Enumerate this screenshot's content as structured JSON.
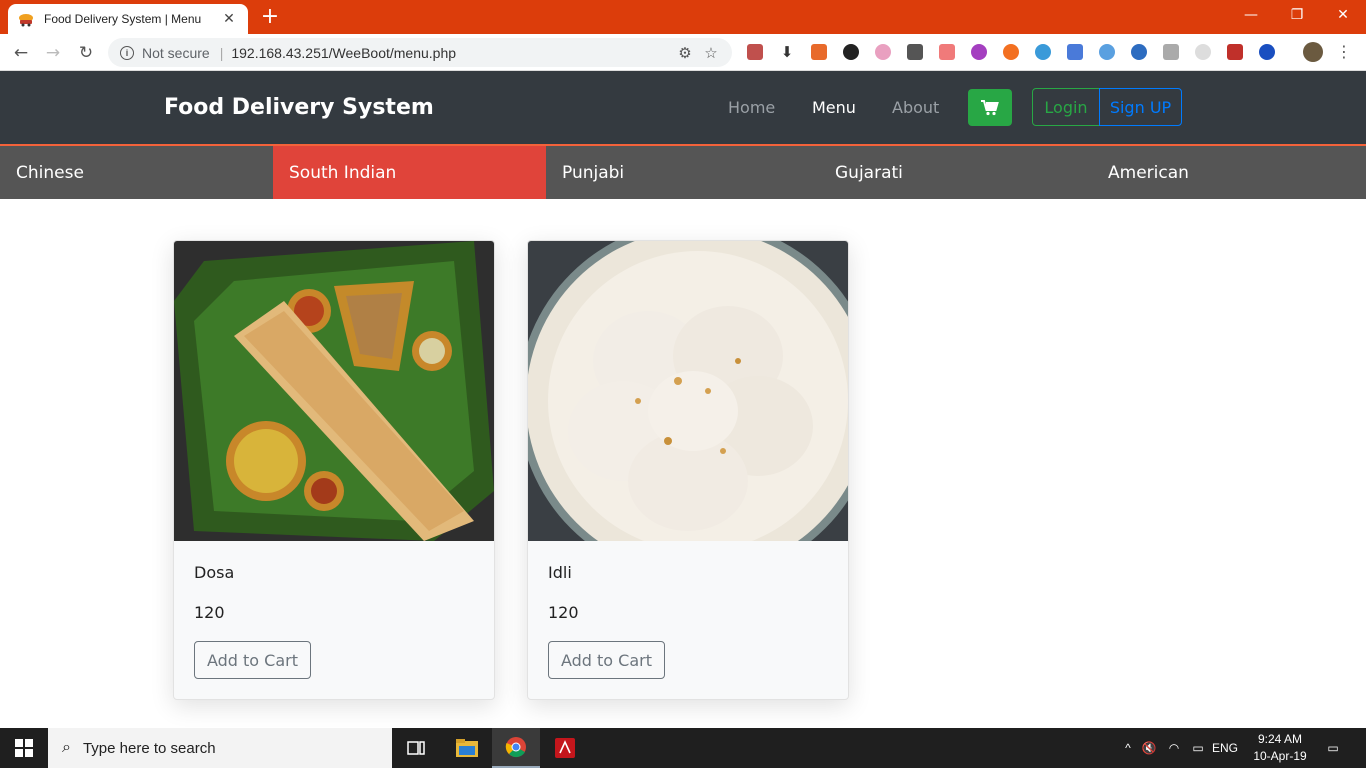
{
  "browser": {
    "tab_title": "Food Delivery System | Menu",
    "security_label": "Not secure",
    "url": "192.168.43.251/WeeBoot/menu.php"
  },
  "site": {
    "brand": "Food Delivery System",
    "nav": {
      "home": "Home",
      "menu": "Menu",
      "about": "About",
      "login": "Login",
      "signup": "Sign UP"
    },
    "categories": [
      "Chinese",
      "South Indian",
      "Punjabi",
      "Gujarati",
      "American"
    ],
    "active_category": "South Indian"
  },
  "items": [
    {
      "name": "Dosa",
      "price": "120",
      "button": "Add to Cart"
    },
    {
      "name": "Idli",
      "price": "120",
      "button": "Add to Cart"
    }
  ],
  "taskbar": {
    "search_placeholder": "Type here to search",
    "language": "ENG",
    "time": "9:24 AM",
    "date": "10-Apr-19"
  },
  "colors": {
    "tabbar": "#dc3d0b",
    "navbar": "#343a40",
    "category_bar": "#555555",
    "active_category": "#e0443a",
    "success": "#28a745",
    "primary": "#007bff"
  }
}
